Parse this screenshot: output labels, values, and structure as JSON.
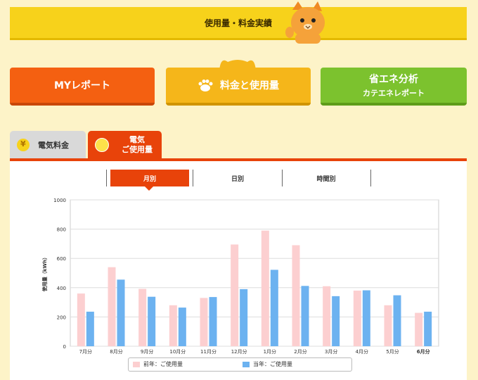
{
  "header": {
    "title": "使用量・料金実績"
  },
  "nav": {
    "my_report": "MYレポート",
    "rates_usage": "料金と使用量",
    "energy_saving": {
      "line1": "省エネ分析",
      "line2": "カテエネレポート"
    }
  },
  "tabs": [
    {
      "label": "電気料金"
    },
    {
      "label_line1": "電気",
      "label_line2": "ご使用量"
    }
  ],
  "segments": [
    "月別",
    "日別",
    "時間別"
  ],
  "colors": {
    "accent": "#e8430a",
    "prev_year": "#fccfd0",
    "this_year": "#6cb2f0"
  },
  "chart_data": {
    "type": "bar",
    "ylabel": "使用量（kWh）",
    "ylim": [
      0,
      1000
    ],
    "yticks": [
      0,
      200,
      400,
      600,
      800,
      1000
    ],
    "categories": [
      "7月分",
      "8月分",
      "9月分",
      "10月分",
      "11月分",
      "12月分",
      "1月分",
      "2月分",
      "3月分",
      "4月分",
      "5月分",
      "6月分"
    ],
    "series": [
      {
        "name": "前年：ご使用量",
        "values": [
          360,
          540,
          392,
          280,
          330,
          695,
          790,
          690,
          410,
          380,
          280,
          228
        ]
      },
      {
        "name": "当年：ご使用量",
        "values": [
          236,
          455,
          338,
          264,
          336,
          390,
          522,
          412,
          342,
          382,
          348,
          236
        ]
      }
    ],
    "highlight_category": "6月分",
    "grid": true,
    "legend": "bottom"
  }
}
